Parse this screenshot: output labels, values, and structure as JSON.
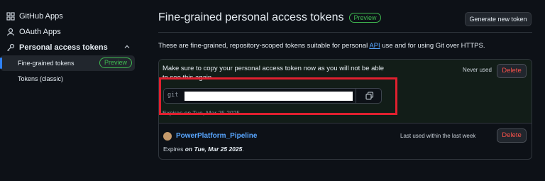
{
  "sidebar": {
    "items": [
      {
        "label": "GitHub Apps",
        "icon": "grid-icon"
      },
      {
        "label": "OAuth Apps",
        "icon": "person-icon"
      },
      {
        "label": "Personal access tokens",
        "icon": "key-icon"
      }
    ],
    "sub_items": [
      {
        "label": "Fine-grained tokens",
        "badge": "Preview",
        "active": true
      },
      {
        "label": "Tokens (classic)",
        "active": false
      }
    ]
  },
  "main": {
    "title": "Fine-grained personal access tokens",
    "title_badge": "Preview",
    "generate_button": "Generate new token",
    "description_before": "These are fine-grained, repository-scoped tokens suitable for personal ",
    "description_link": "API",
    "description_after": " use and for using Git over HTTPS.",
    "new_token": {
      "notice": "Make sure to copy your personal access token now as you will not be able to see this again.",
      "status": "Never used",
      "delete_label": "Delete",
      "token_prefix": "git",
      "expires_text": "Expires on Tue, Mar 25 2025."
    },
    "token": {
      "name": "PowerPlatform_Pipeline",
      "status": "Last used within the last week",
      "delete_label": "Delete",
      "expires_prefix": "Expires ",
      "expires_date": "on Tue, Mar 25 2025",
      "expires_suffix": "."
    }
  },
  "colors": {
    "background": "#0d1117",
    "accent_link": "#58a6ff",
    "preview_green": "#3fb950",
    "danger": "#f85149",
    "highlight_box": "#e0202f"
  }
}
